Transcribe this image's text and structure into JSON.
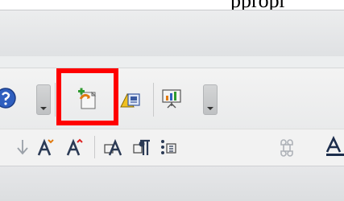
{
  "top_fragment": "ppropr",
  "toolbar_top": {
    "buttons": [
      {
        "name": "help-icon"
      },
      {
        "name": "toolbar-dropdown-1"
      },
      {
        "name": "insert-new-slide-icon"
      },
      {
        "name": "slide-layout-icon"
      },
      {
        "name": "slide-show-icon"
      },
      {
        "name": "toolbar-dropdown-2"
      }
    ]
  },
  "toolbar_bottom": {
    "buttons": [
      {
        "name": "move-down-icon"
      },
      {
        "name": "increase-font-icon"
      },
      {
        "name": "decrease-font-icon"
      },
      {
        "name": "text-frame-icon"
      },
      {
        "name": "paragraph-icon"
      },
      {
        "name": "bullets-icon"
      },
      {
        "name": "command-icon"
      },
      {
        "name": "font-color-icon"
      }
    ]
  },
  "colors": {
    "highlight": "#ff0000",
    "help_blue": "#2f5fbf",
    "accent_orange": "#e07a10",
    "accent_green": "#2e9a2e"
  }
}
